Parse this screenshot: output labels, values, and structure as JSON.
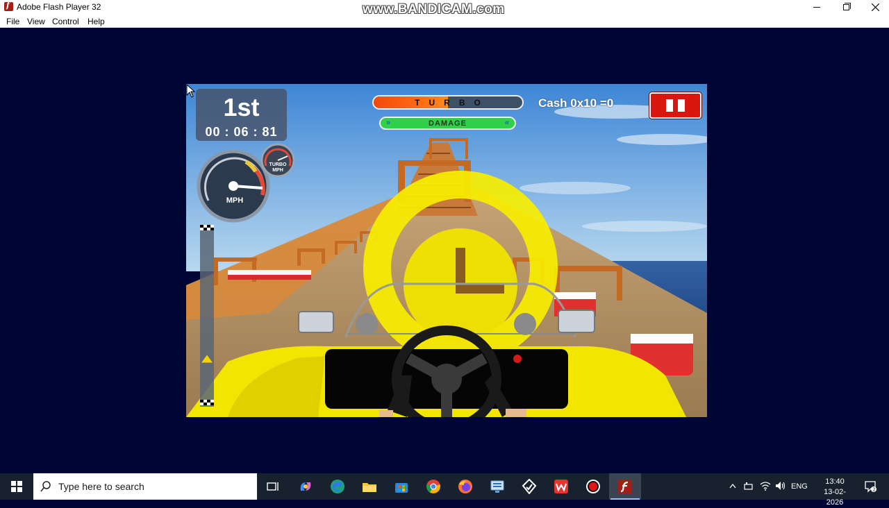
{
  "window": {
    "title": "Adobe Flash Player 32",
    "watermark": "www.BANDICAM.com",
    "controls": [
      "minimize",
      "maximize",
      "close"
    ]
  },
  "menu": {
    "items": [
      {
        "label": "File"
      },
      {
        "label": "View"
      },
      {
        "label": "Control"
      },
      {
        "label": "Help"
      }
    ]
  },
  "game": {
    "race_position": "1st",
    "timer": "00 : 06 : 81",
    "turbo_label": "TURBO",
    "turbo_level": 0.5,
    "damage_label": "DAMAGE",
    "damage_arrow_left": "»",
    "damage_arrow_right": "«",
    "cash": "Cash 0x10 =0",
    "speedometer_unit": "MPH",
    "turbo_gauge_label_1": "TURBO",
    "turbo_gauge_label_2": "MPH",
    "track_progress": 0.24,
    "colors": {
      "car_yellow": "#f2e600",
      "sky": "#5aa3e0",
      "sea": "#1f4d8f",
      "ramp_wood": "#c8762f",
      "pause_red": "#d9160f",
      "damage_green": "#2fd14b",
      "turbo_orange": "#f24a0c"
    }
  },
  "taskbar": {
    "search_placeholder": "Type here to search",
    "apps": [
      "task-view-icon",
      "copilot-icon",
      "edge-icon",
      "file-explorer-icon",
      "store-icon",
      "chrome-icon",
      "firefox-icon",
      "network-app-icon",
      "shield-app-icon",
      "wps-icon",
      "bandicam-record-icon",
      "flash-player-icon"
    ],
    "language": "ENG",
    "time": "13:40",
    "date": "13-02-2026"
  }
}
